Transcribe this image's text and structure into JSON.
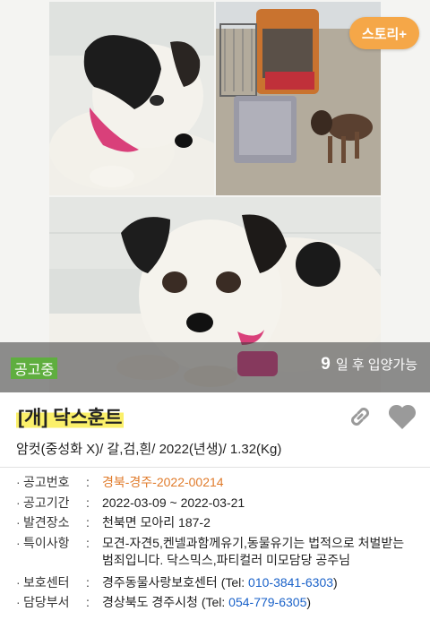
{
  "header": {
    "story_button": "스토리+"
  },
  "status": {
    "badge": "공고중",
    "adopt_days": "9",
    "adopt_suffix": "일 후 입양가능"
  },
  "animal": {
    "title": "[개] 닥스훈트",
    "summary": "암컷(중성화 X)/ 갈,검,흰/ 2022(년생)/ 1.32(Kg)"
  },
  "details": {
    "notice_no_label": "공고번호",
    "notice_no": "경북-경주-2022-00214",
    "period_label": "공고기간",
    "period": "2022-03-09 ~ 2022-03-21",
    "found_label": "발견장소",
    "found": "천북면 모아리 187-2",
    "notes_label": "특이사항",
    "notes_line1": "모견-자견5,켄넬과함께유기,동물유기는 법적으로 처벌받는",
    "notes_line2": "범죄입니다. 닥스믹스,파티컬러 미모담당 공주님",
    "center_label": "보호센터",
    "center_name": "경주동물사랑보호센터",
    "center_tel_prefix": "(Tel:",
    "center_tel": "010-3841-6303",
    "center_tel_suffix": ")",
    "office_label": "담당부서",
    "office_name": "경상북도 경주시청",
    "office_tel_prefix": "(Tel:",
    "office_tel": "054-779-6305",
    "office_tel_suffix": ")",
    "colon": ":"
  },
  "icons": {
    "link": "link-icon",
    "favorite": "heart-icon"
  },
  "colors": {
    "story_button": "#f5a748",
    "status_badge": "#5fae3f",
    "highlight": "#fbf06a",
    "notice_number": "#e07b2b",
    "phone": "#1a62c9"
  }
}
